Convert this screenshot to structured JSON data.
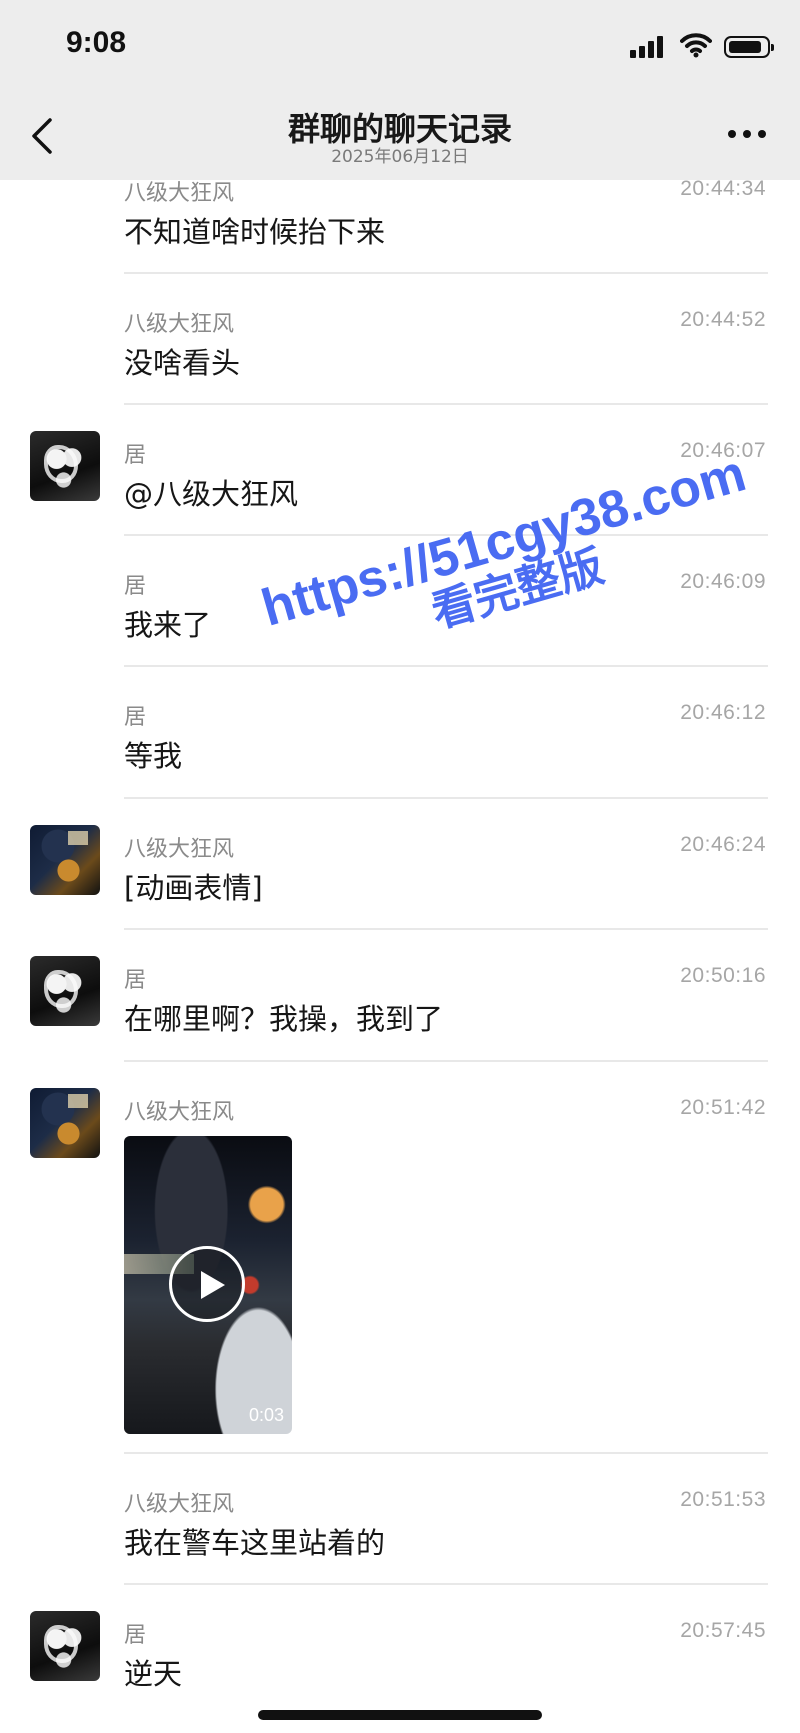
{
  "status_bar": {
    "time": "9:08"
  },
  "nav": {
    "title": "群聊的聊天记录",
    "subtitle": "2025年06月12日"
  },
  "messages": [
    {
      "sender": "八级大狂风",
      "time": "20:44:34",
      "text": "不知道啥时候抬下来"
    },
    {
      "sender": "八级大狂风",
      "time": "20:44:52",
      "text": "没啥看头"
    },
    {
      "sender": "居",
      "time": "20:46:07",
      "text": "@八级大狂风"
    },
    {
      "sender": "居",
      "time": "20:46:09",
      "text": "我来了"
    },
    {
      "sender": "居",
      "time": "20:46:12",
      "text": "等我"
    },
    {
      "sender": "八级大狂风",
      "time": "20:46:24",
      "text": "[动画表情]"
    },
    {
      "sender": "居",
      "time": "20:50:16",
      "text": "在哪里啊？我操，我到了"
    },
    {
      "sender": "八级大狂风",
      "time": "20:51:42",
      "video_duration": "0:03"
    },
    {
      "sender": "八级大狂风",
      "time": "20:51:53",
      "text": "我在警车这里站着的"
    },
    {
      "sender": "居",
      "time": "20:57:45",
      "text": "逆天"
    }
  ],
  "watermark": {
    "url": "https://51cgy38.com",
    "subtitle": "看完整版"
  },
  "icons": {
    "back": "chevron-left-icon",
    "more": "more-horizontal-icon",
    "signal": "signal-icon",
    "wifi": "wifi-icon",
    "battery": "battery-icon",
    "play": "play-icon"
  }
}
